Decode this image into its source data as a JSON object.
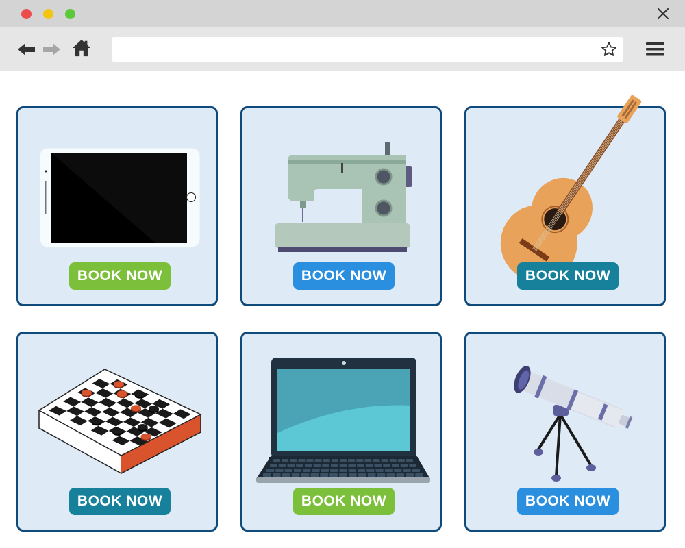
{
  "window": {
    "controls": [
      {
        "name": "close",
        "color": "#ec4c4c"
      },
      {
        "name": "minimize",
        "color": "#f2c50f"
      },
      {
        "name": "maximize",
        "color": "#5cc93a"
      }
    ]
  },
  "toolbar": {
    "address_value": "",
    "icons": [
      "back-arrow-icon",
      "forward-arrow-icon",
      "home-icon",
      "star-icon",
      "hamburger-menu-icon"
    ]
  },
  "items": [
    {
      "product": "tablet",
      "button_label": "BOOK NOW",
      "button_color": "#7cbf3a"
    },
    {
      "product": "sewing-machine",
      "button_label": "BOOK NOW",
      "button_color": "#2a8fde"
    },
    {
      "product": "guitar",
      "button_label": "BOOK NOW",
      "button_color": "#17819b"
    },
    {
      "product": "checkers-board",
      "button_label": "BOOK NOW",
      "button_color": "#17819b"
    },
    {
      "product": "laptop",
      "button_label": "BOOK NOW",
      "button_color": "#7cbf3a"
    },
    {
      "product": "telescope",
      "button_label": "BOOK NOW",
      "button_color": "#2a8fde"
    }
  ],
  "colors": {
    "card_background": "#deebf6",
    "card_border": "#0e4a7b",
    "titlebar": "#d4d4d4",
    "toolbar": "#e6e6e6"
  }
}
